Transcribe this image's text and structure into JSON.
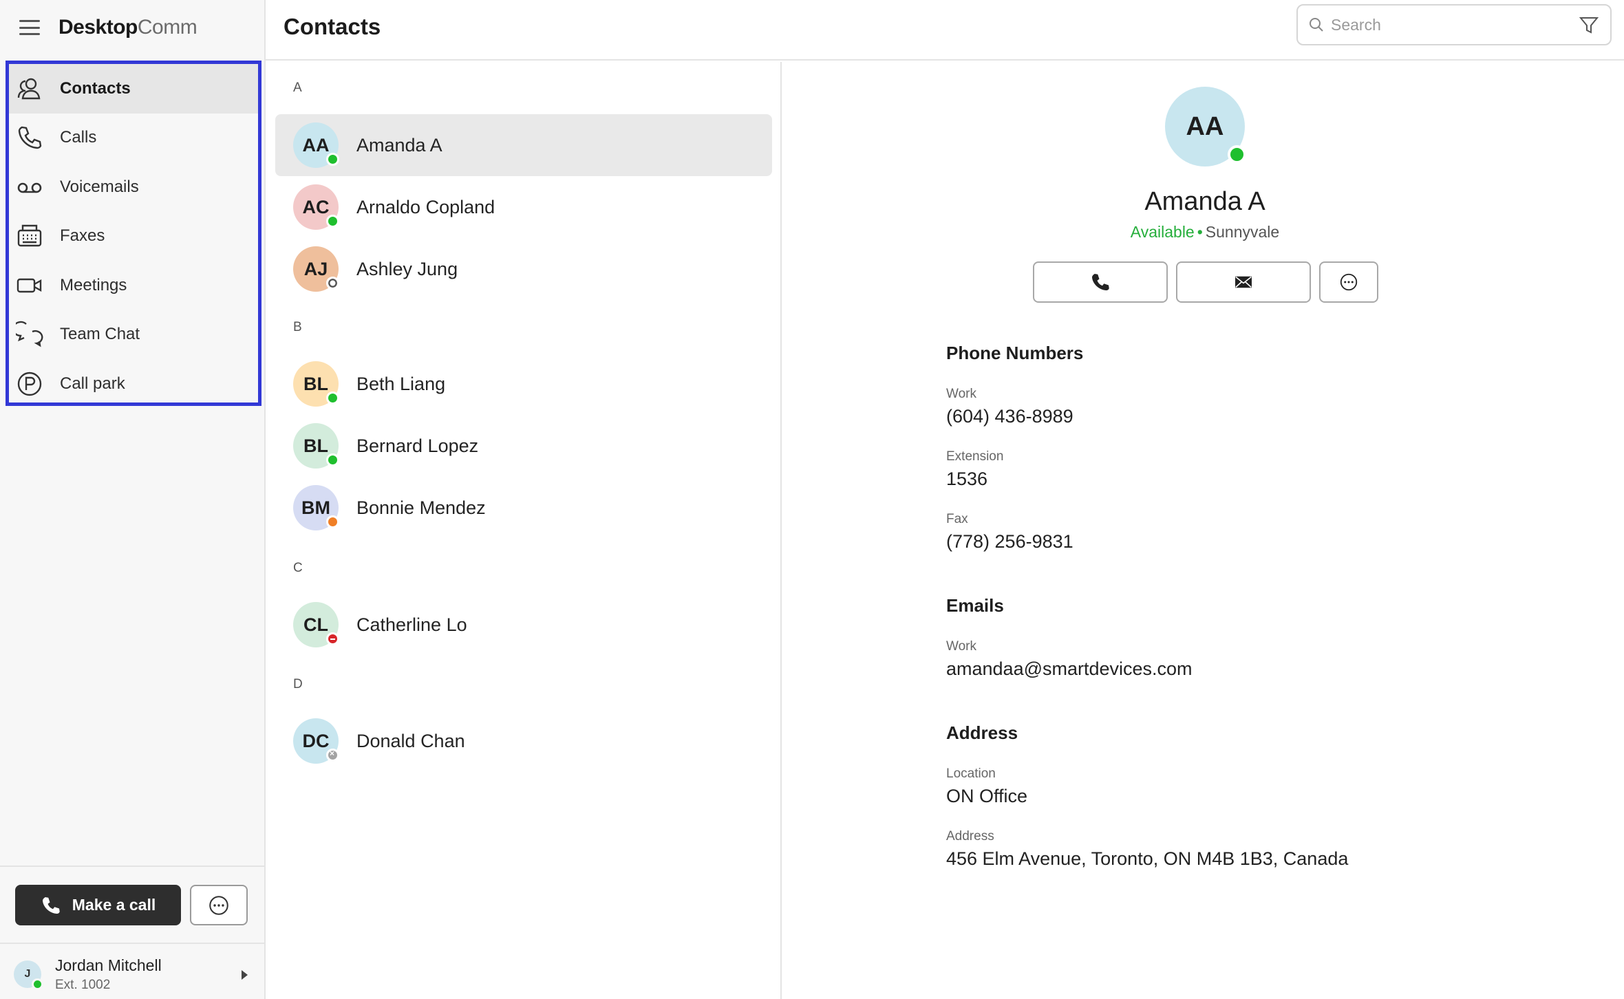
{
  "app": {
    "brand_bold": "Desktop",
    "brand_light": "Comm"
  },
  "header": {
    "title": "Contacts"
  },
  "search": {
    "placeholder": "Search"
  },
  "sidebar": {
    "items": [
      {
        "label": "Contacts",
        "icon": "contacts-icon",
        "active": true
      },
      {
        "label": "Calls",
        "icon": "phone-icon"
      },
      {
        "label": "Voicemails",
        "icon": "voicemail-icon"
      },
      {
        "label": "Faxes",
        "icon": "fax-icon"
      },
      {
        "label": "Meetings",
        "icon": "video-camera-icon"
      },
      {
        "label": "Team Chat",
        "icon": "chat-bubbles-icon"
      },
      {
        "label": "Call park",
        "icon": "parking-icon"
      }
    ],
    "make_call_label": "Make a call",
    "user": {
      "initials": "J",
      "name": "Jordan Mitchell",
      "ext": "Ext. 1002",
      "status": "available"
    }
  },
  "contact_list": {
    "sections": [
      "A",
      "B",
      "C",
      "D"
    ],
    "contacts": [
      {
        "initials": "AA",
        "name": "Amanda A",
        "status": "available",
        "color": "#c8e6ef",
        "selected": true
      },
      {
        "initials": "AC",
        "name": "Arnaldo Copland",
        "status": "available",
        "color": "#f3c9c9"
      },
      {
        "initials": "AJ",
        "name": "Ashley Jung",
        "status": "away",
        "color": "#efbf9c"
      },
      {
        "initials": "BL",
        "name": "Beth Liang",
        "status": "available",
        "color": "#fde0b0"
      },
      {
        "initials": "BL",
        "name": "Bernard Lopez",
        "status": "available",
        "color": "#d3ecdc"
      },
      {
        "initials": "BM",
        "name": "Bonnie Mendez",
        "status": "busy",
        "color": "#d6dcf3"
      },
      {
        "initials": "CL",
        "name": "Catherline Lo",
        "status": "do-not-disturb",
        "color": "#d3ecdc"
      },
      {
        "initials": "DC",
        "name": "Donald Chan",
        "status": "offline",
        "color": "#c8e6ef"
      }
    ]
  },
  "detail": {
    "initials": "AA",
    "name": "Amanda A",
    "status_text": "Available",
    "separator": "•",
    "location": "Sunnyvale",
    "phone_section": "Phone Numbers",
    "work_label": "Work",
    "work_phone": "(604) 436-8989",
    "extension_label": "Extension",
    "extension": "1536",
    "fax_label": "Fax",
    "fax": "(778) 256-9831",
    "emails_section": "Emails",
    "email_label": "Work",
    "email": "amandaa@smartdevices.com",
    "address_section": "Address",
    "location_label": "Location",
    "location_value": "ON Office",
    "address_label": "Address",
    "address_value": "456 Elm Avenue, Toronto, ON M4B 1B3, Canada"
  },
  "colors": {
    "accent_frame": "#3238d6",
    "available": "#1fbf2e",
    "busy": "#f07f26",
    "dnd": "#d7262a"
  }
}
